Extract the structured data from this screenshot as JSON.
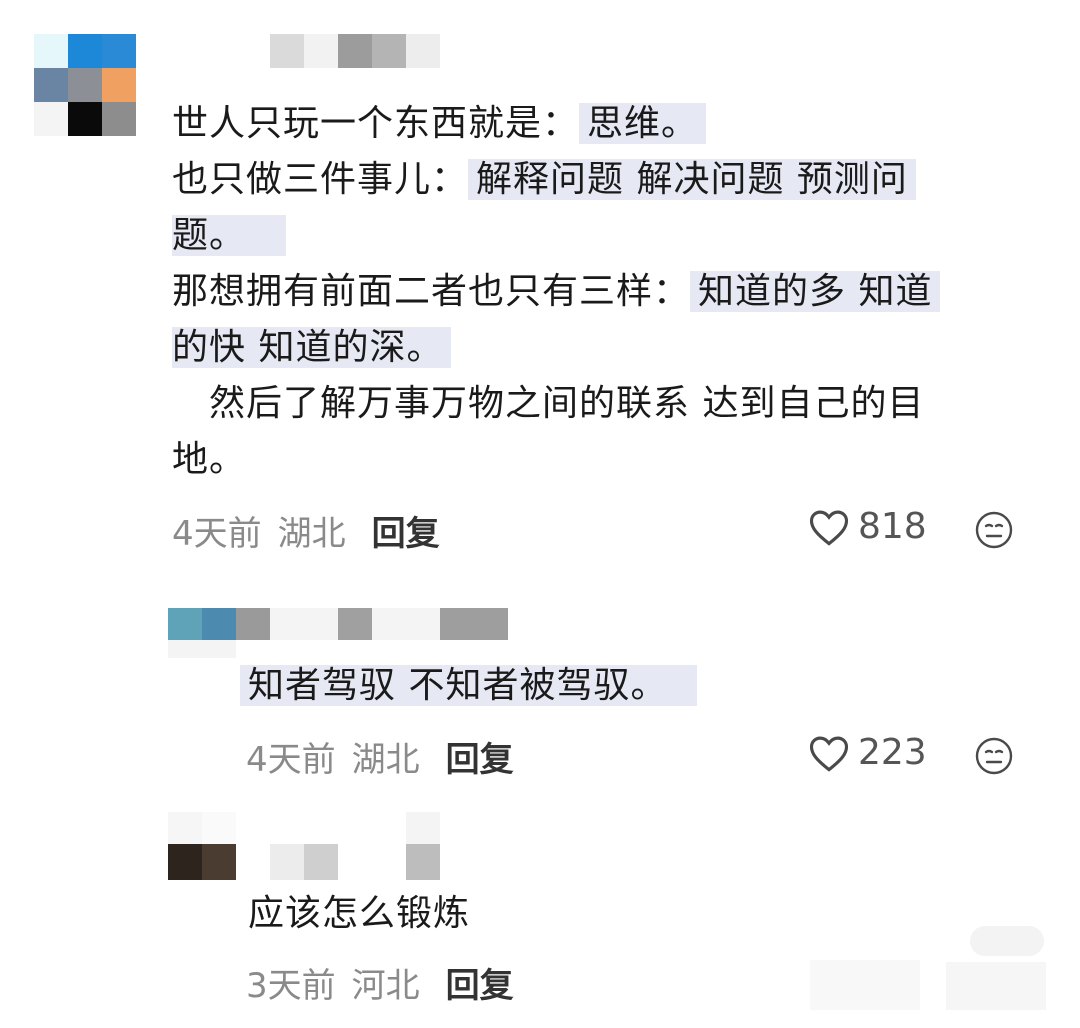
{
  "comments": [
    {
      "lines": [
        {
          "plain": "世人只玩一个东西就是：",
          "hl": "思维。"
        },
        {
          "plain": "也只做三件事儿：",
          "hl": "解释问题 解决问题 预测问"
        },
        {
          "plain": "",
          "hl": "题。"
        },
        {
          "plain": "那想拥有前面二者也只有三样：",
          "hl": "知道的多 知道"
        },
        {
          "plain": "",
          "hl": "的快 知道的深。"
        },
        {
          "plain": "　然后了解万事万物之间的联系 达到自己的目",
          "hl": ""
        },
        {
          "plain": "地。",
          "hl": ""
        }
      ],
      "time": "4天前",
      "location": "湖北",
      "reply_label": "回复",
      "likes": "818"
    },
    {
      "lines": [
        {
          "plain": "",
          "hl": "知者驾驭 不知者被驾驭。"
        }
      ],
      "time": "4天前",
      "location": "湖北",
      "reply_label": "回复",
      "likes": "223"
    },
    {
      "lines": [
        {
          "plain": "应该怎么锻炼",
          "hl": ""
        }
      ],
      "time": "3天前",
      "location": "河北",
      "reply_label": "回复"
    }
  ],
  "icons": {
    "like": "heart-outline-icon",
    "react": "neutral-face-icon"
  },
  "colors": {
    "highlight": "#e6e8f4",
    "meta_gray": "#8a8a8a"
  }
}
